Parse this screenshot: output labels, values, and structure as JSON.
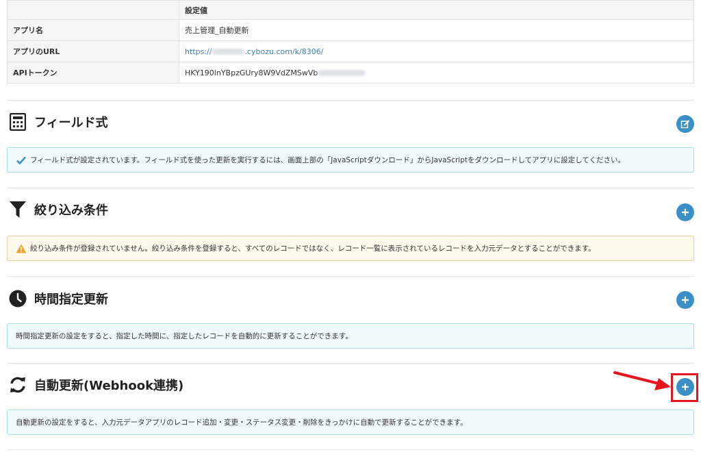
{
  "table": {
    "header_value": "設定値",
    "rows": [
      {
        "key": "アプリ名",
        "value": "売上管理_自動更新"
      },
      {
        "key": "アプリのURL",
        "value_prefix": "https://",
        "value_suffix": ".cybozu.com/k/8306/"
      },
      {
        "key": "APIトークン",
        "value": "HKY190lnYBpzGUry8W9VdZMSwVb"
      }
    ]
  },
  "sections": {
    "field_formula": {
      "title": "フィールド式",
      "icon": "calculator-icon",
      "button": "edit",
      "message": "フィールド式が設定されています。フィールド式を使った更新を実行するには、画面上部の「JavaScriptダウンロード」からJavaScriptをダウンロードしてアプリに設定してください。"
    },
    "filter": {
      "title": "絞り込み条件",
      "icon": "filter-icon",
      "button": "add",
      "message": "絞り込み条件が登録されていません。絞り込み条件を登録すると、すべてのレコードではなく、レコード一覧に表示されているレコードを入力元データとすることができます。"
    },
    "scheduled": {
      "title": "時間指定更新",
      "icon": "clock-icon",
      "button": "add",
      "message": "時間指定更新の設定をすると、指定した時間に、指定したレコードを自動的に更新することができます。"
    },
    "webhook": {
      "title": "自動更新(Webhook連携)",
      "icon": "refresh-icon",
      "button": "add",
      "message": "自動更新の設定をすると、入力元データアプリのレコード追加・変更・ステータス変更・削除をきっかけに自動で更新することができます。"
    }
  },
  "colors": {
    "accent": "#3a8fc6",
    "annotation": "#e6141e",
    "info_border": "#a9dfe8",
    "warn_border": "#e9cf9c",
    "warn_icon": "#f0a22e"
  }
}
